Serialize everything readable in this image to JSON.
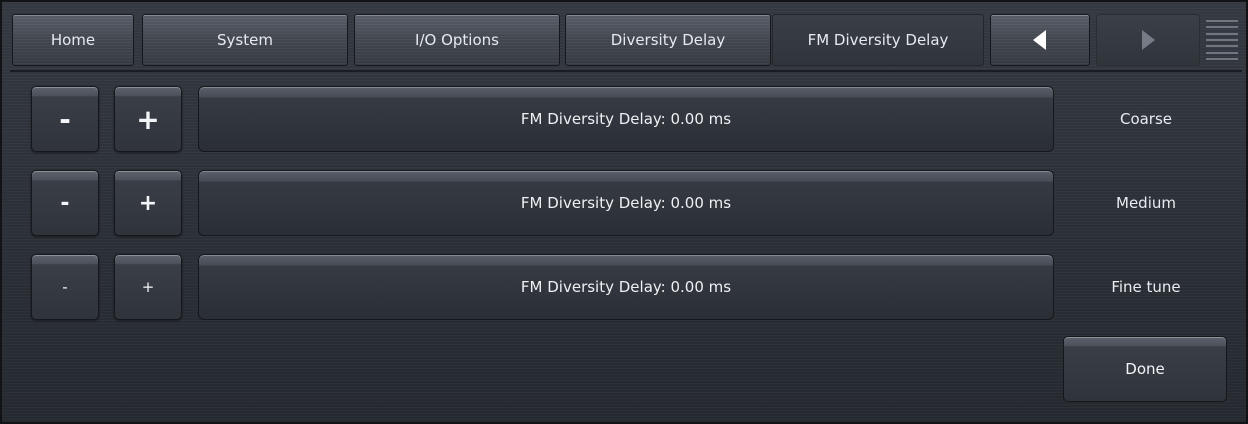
{
  "tabs": [
    {
      "label": "Home"
    },
    {
      "label": "System"
    },
    {
      "label": "I/O Options"
    },
    {
      "label": "Diversity Delay"
    },
    {
      "label": "FM Diversity Delay"
    }
  ],
  "nav": {
    "prev_icon": "triangle-left-icon",
    "next_icon": "triangle-right-icon",
    "menu_icon": "menu-lines-icon"
  },
  "rows": [
    {
      "minus": "-",
      "plus": "+",
      "value": "FM Diversity Delay: 0.00 ms",
      "step": "Coarse"
    },
    {
      "minus": "-",
      "plus": "+",
      "value": "FM Diversity Delay: 0.00 ms",
      "step": "Medium"
    },
    {
      "minus": "-",
      "plus": "+",
      "value": "FM Diversity Delay: 0.00 ms",
      "step": "Fine tune"
    }
  ],
  "done_label": "Done",
  "colors": {
    "background": "#2b2f36",
    "text": "#e8ebef",
    "button_top": "#5d636d"
  }
}
